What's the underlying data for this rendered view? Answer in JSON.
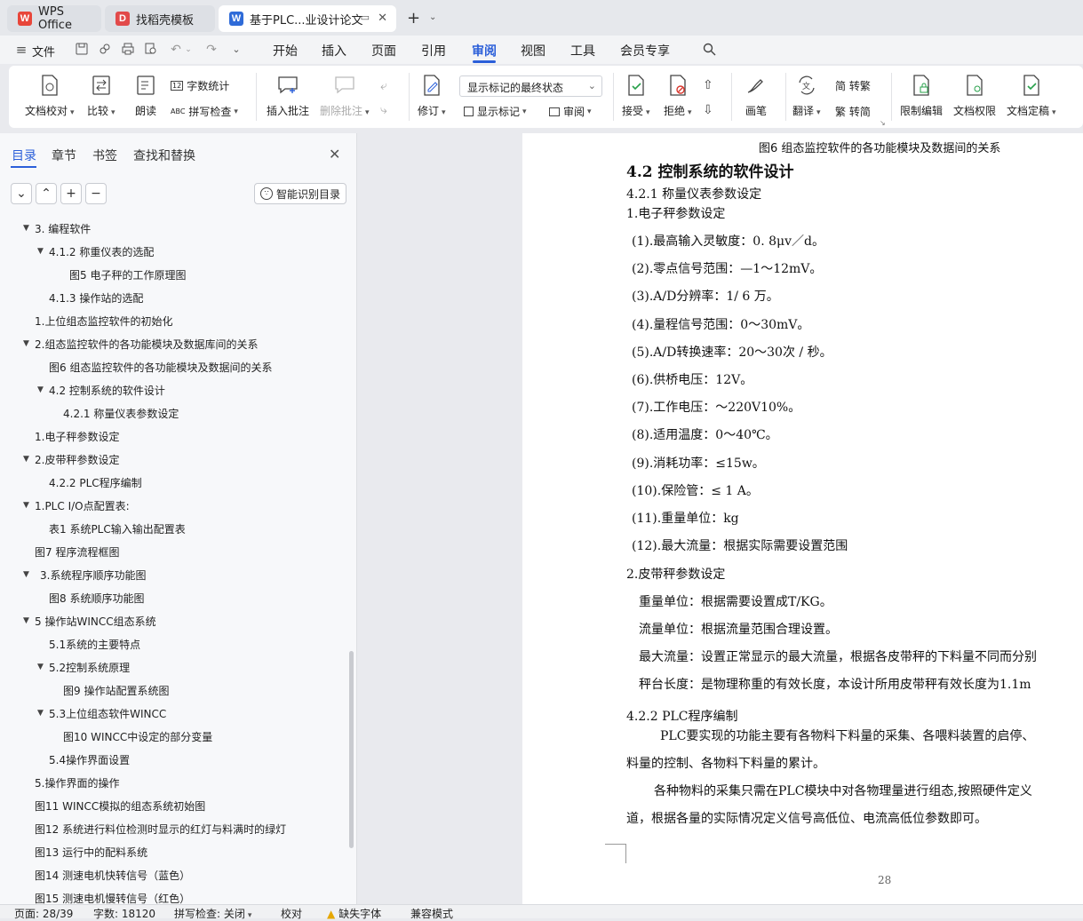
{
  "tabs": [
    {
      "label": "WPS Office",
      "icon": "wps-logo-icon"
    },
    {
      "label": "找稻壳模板",
      "icon": "docer-logo-icon"
    },
    {
      "label": "基于PLC...业设计论文",
      "icon": "writer-logo-icon"
    }
  ],
  "menu": {
    "file": "文件",
    "items": [
      "开始",
      "插入",
      "页面",
      "引用",
      "审阅",
      "视图",
      "工具",
      "会员专享"
    ],
    "active": "审阅"
  },
  "ribbon": {
    "doc_check": "文档校对",
    "compare": "比较",
    "read_aloud": "朗读",
    "word_count": "字数统计",
    "spell_check": "拼写检查",
    "insert_comment": "插入批注",
    "delete_comment": "删除批注",
    "revise": "修订",
    "display_select": "显示标记的最终状态",
    "show_markup": "显示标记",
    "review": "审阅",
    "accept": "接受",
    "reject": "拒绝",
    "pen": "画笔",
    "translate": "翻译",
    "to_traditional": "简 转繁",
    "to_simplified": "繁 转简",
    "restrict_edit": "限制编辑",
    "doc_permission": "文档权限",
    "doc_finalize": "文档定稿"
  },
  "nav": {
    "tabs": [
      "目录",
      "章节",
      "书签",
      "查找和替换"
    ],
    "smart_toc": "智能识别目录",
    "toc": [
      {
        "label": "3. 编程软件",
        "expand": "▼"
      },
      {
        "label": "4.1.2 称重仪表的选配",
        "expand": "▼"
      },
      {
        "label": "图5 电子秤的工作原理图",
        "expand": ""
      },
      {
        "label": "4.1.3 操作站的选配",
        "expand": ""
      },
      {
        "label": "1.上位组态监控软件的初始化",
        "expand": ""
      },
      {
        "label": "2.组态监控软件的各功能模块及数据库间的关系",
        "expand": "▼"
      },
      {
        "label": "图6 组态监控软件的各功能模块及数据间的关系",
        "expand": ""
      },
      {
        "label": "4.2 控制系统的软件设计",
        "expand": "▼"
      },
      {
        "label": "4.2.1 称量仪表参数设定",
        "expand": ""
      },
      {
        "label": "1.电子秤参数设定",
        "expand": ""
      },
      {
        "label": "2.皮带秤参数设定",
        "expand": "▼"
      },
      {
        "label": "4.2.2 PLC程序编制",
        "expand": ""
      },
      {
        "label": "1.PLC I/O点配置表:",
        "expand": "▼"
      },
      {
        "label": "表1 系统PLC输入输出配置表",
        "expand": ""
      },
      {
        "label": "图7 程序流程框图",
        "expand": ""
      },
      {
        "label": " 3.系统程序顺序功能图",
        "expand": "▼"
      },
      {
        "label": "图8 系统顺序功能图",
        "expand": ""
      },
      {
        "label": "5 操作站WINCC组态系统",
        "expand": "▼"
      },
      {
        "label": "5.1系统的主要特点",
        "expand": ""
      },
      {
        "label": "5.2控制系统原理",
        "expand": "▼"
      },
      {
        "label": "图9 操作站配置系统图",
        "expand": ""
      },
      {
        "label": "5.3上位组态软件WINCC",
        "expand": "▼"
      },
      {
        "label": "图10 WINCC中设定的部分变量",
        "expand": ""
      },
      {
        "label": "5.4操作界面设置",
        "expand": ""
      },
      {
        "label": "5.操作界面的操作",
        "expand": ""
      },
      {
        "label": "图11 WINCC模拟的组态系统初始图",
        "expand": ""
      },
      {
        "label": "图12 系统进行料位检测时显示的红灯与料满时的绿灯",
        "expand": ""
      },
      {
        "label": "图13 运行中的配料系统",
        "expand": ""
      },
      {
        "label": "图14 测速电机快转信号（蓝色）",
        "expand": ""
      },
      {
        "label": "图15 测速电机慢转信号（红色）",
        "expand": ""
      }
    ]
  },
  "document": {
    "caption": "图6 组态监控软件的各功能模块及数据间的关系",
    "heading": "4.2  控制系统的软件设计",
    "sub1": "4.2.1  称量仪表参数设定",
    "p_scale": "1.电子秤参数设定",
    "scale_params": [
      "(1).最高输入灵敏度：0. 8μv／d。",
      "(2).零点信号范围：—1～12mV。",
      "(3).A/D分辨率：1/ 6  万。",
      "(4).量程信号范围：0～30mV。",
      "(5).A/D转换速率：20～30次  /  秒。",
      "(6).供桥电压：12V。",
      "(7).工作电压：～220V10%。",
      "(8).适用温度：0～40℃。",
      "(9).消耗功率：≤15w。",
      "(10).保险管：≤ 1 A。",
      "(11).重量单位：kg",
      "(12).最大流量：根据实际需要设置范围"
    ],
    "p_belt": "2.皮带秤参数设定",
    "belt_params": [
      "重量单位：根据需要设置成T/KG。",
      "流量单位：根据流量范围合理设置。",
      "最大流量：设置正常显示的最大流量，根据各皮带秤的下料量不同而分别",
      "秤台长度：是物理称重的有效长度，本设计所用皮带秤有效长度为1.1m"
    ],
    "sub2": "4.2.2 PLC程序编制",
    "para1_line1": "PLC要实现的功能主要有各物料下料量的采集、各喂料装置的启停、",
    "para1_line2": "料量的控制、各物料下料量的累计。",
    "para2_line1": "各种物料的采集只需在PLC模块中对各物理量进行组态,按照硬件定义",
    "para2_line2": "道，根据各量的实际情况定义信号高低位、电流高低位参数即可。",
    "page_number": "28"
  },
  "status": {
    "page": "页面: 28/39",
    "words": "字数: 18120",
    "spell": "拼写检查: 关闭",
    "proof": "校对",
    "missing_font": "缺失字体",
    "compat": "兼容模式"
  },
  "colors": {
    "accent": "#2b5fd9",
    "wps_red": "#e8463a",
    "writer_blue": "#2f6bd8"
  }
}
